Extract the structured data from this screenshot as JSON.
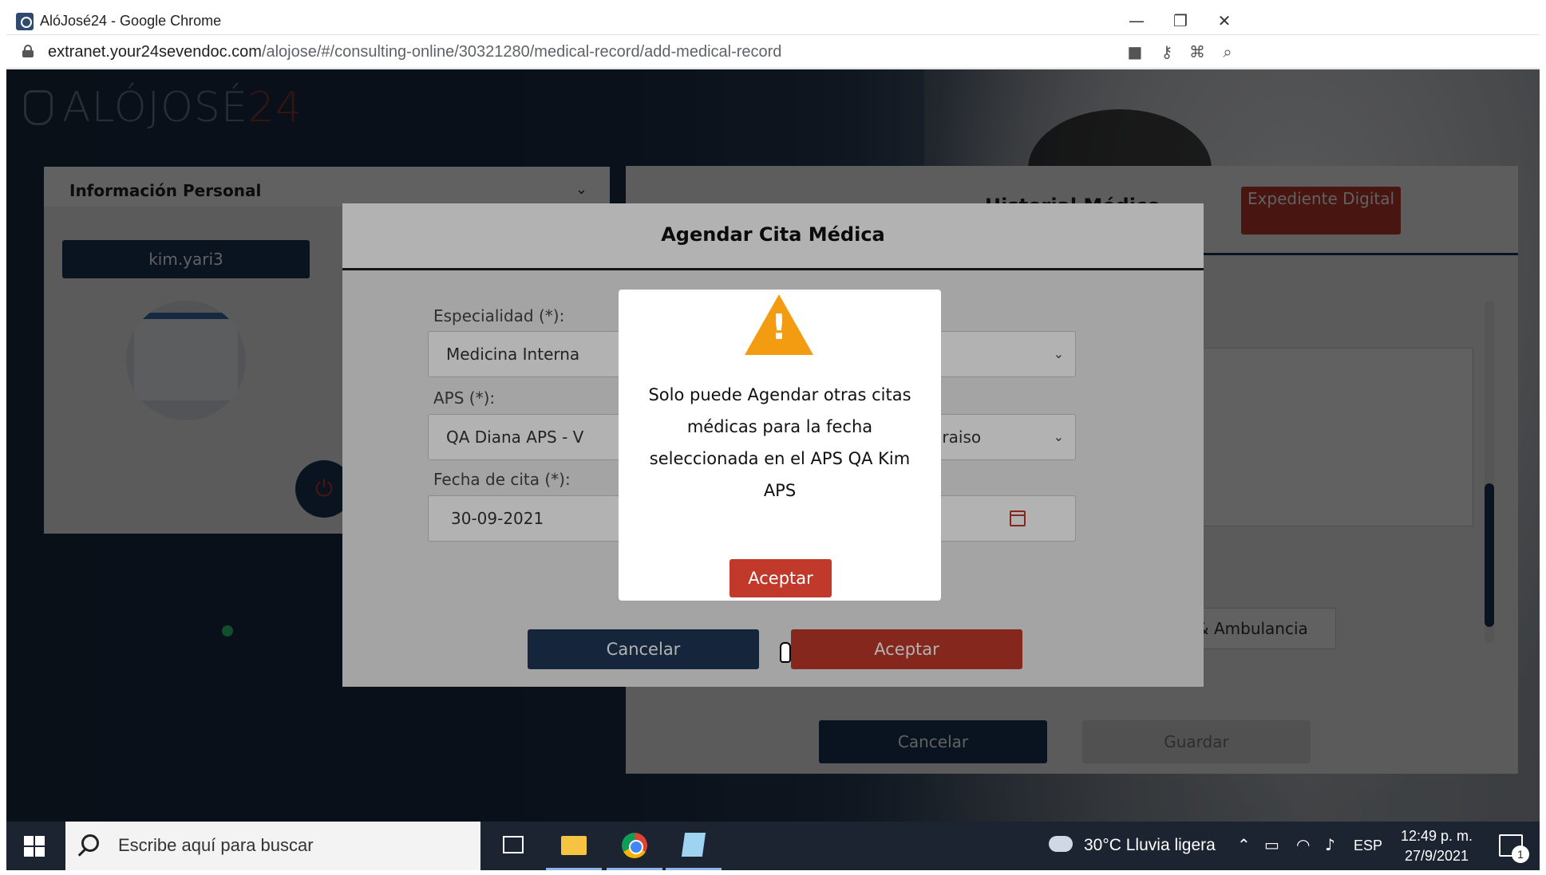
{
  "window": {
    "title": "AlóJosé24 - Google Chrome",
    "controls": {
      "minimize": "—",
      "restore": "❐",
      "close": "✕"
    }
  },
  "address_bar": {
    "url_host": "extranet.your24sevendoc.com",
    "url_path": "/alojose/#/consulting-online/30321280/medical-record/add-medical-record",
    "icons": [
      "camera-icon",
      "key-icon",
      "translate-icon",
      "zoom-icon"
    ]
  },
  "app": {
    "logo_text": "ALÓJOSÉ",
    "logo_num": "24",
    "left_panel": {
      "header": "Información Personal",
      "username": "kim.yari3"
    },
    "right_panel": {
      "tab_title": "Historial Médico",
      "expediente_button": "Expediente Digital",
      "ambulancia_button": "& Ambulancia",
      "cancel_button": "Cancelar",
      "save_button": "Guardar"
    }
  },
  "modal": {
    "title": "Agendar Cita Médica",
    "especialidad": {
      "label": "Especialidad (*):",
      "value": "Medicina Interna"
    },
    "aps": {
      "label": "APS (*):",
      "value": "QA Diana APS - V",
      "value_right": "Paraiso"
    },
    "fecha": {
      "label": "Fecha de cita (*):",
      "value": "30-09-2021"
    },
    "cancel_button": "Cancelar",
    "accept_button": "Aceptar"
  },
  "alert": {
    "icon": "warning-icon",
    "message": "Solo puede Agendar otras citas médicas para la fecha seleccionada en el APS QA Kim APS",
    "ok_button": "Aceptar"
  },
  "taskbar": {
    "search_placeholder": "Escribe aquí para buscar",
    "weather": "30°C  Lluvia ligera",
    "language": "ESP",
    "time": "12:49 p. m.",
    "date": "27/9/2021",
    "notification_count": "1"
  },
  "colors": {
    "navy": "#1d3557",
    "accent_red": "#c0392b",
    "warning_orange": "#f39c12"
  }
}
